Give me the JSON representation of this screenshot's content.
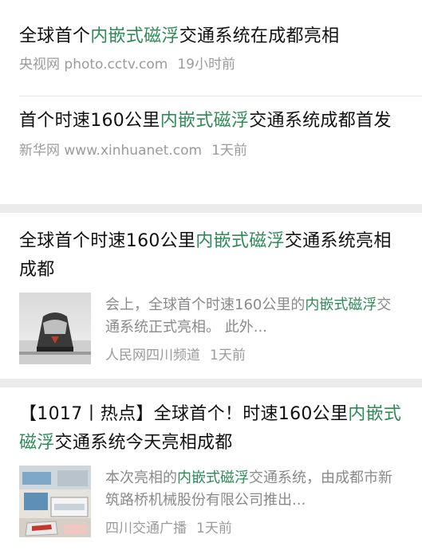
{
  "items": [
    {
      "title_pre": "全球首个",
      "title_hl": "内嵌式磁浮",
      "title_post": "交通系统在成都亮相",
      "source": "央视网 photo.cctv.com",
      "time": "19小时前"
    },
    {
      "title_pre": "首个时速160公里",
      "title_hl": "内嵌式磁浮",
      "title_post": "交通系统成都首发",
      "source": "新华网 www.xinhuanet.com",
      "time": "1天前"
    },
    {
      "title_pre": "全球首个时速160公里",
      "title_hl": "内嵌式磁浮",
      "title_post": "交通系统亮相成都",
      "snippet_pre": "会上，全球首个时速160公里的",
      "snippet_hl": "内嵌式磁浮",
      "snippet_post": "交通系统正式亮相。 此外...",
      "source": "人民网四川频道",
      "time": "1天前"
    },
    {
      "title_pre": "【1017丨热点】全球首个！时速160公里",
      "title_hl": "内嵌式磁浮",
      "title_post": "交通系统今天亮相成都",
      "snippet_pre": "本次亮相的",
      "snippet_hl": "内嵌式磁浮",
      "snippet_post": "交通系统，由成都市新筑路桥机械股份有限公司推出...",
      "source": "四川交通广播",
      "time": "1天前"
    }
  ],
  "colors": {
    "highlight": "#2e8b57",
    "meta": "#9b9b9b",
    "background": "#ebebeb"
  }
}
